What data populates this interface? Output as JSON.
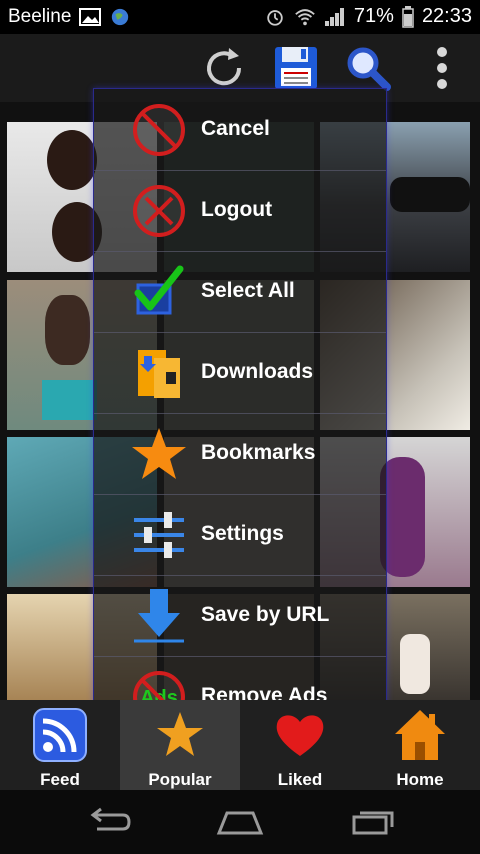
{
  "status_bar": {
    "carrier": "Beeline",
    "battery": "71%",
    "time": "22:33"
  },
  "action_bar": {
    "icons": [
      "refresh-icon",
      "save-icon",
      "search-icon",
      "overflow-icon"
    ]
  },
  "menu": {
    "items": [
      {
        "label": "Cancel",
        "icon": "cancel-icon"
      },
      {
        "label": "Logout",
        "icon": "logout-icon"
      },
      {
        "label": "Select All",
        "icon": "checkbox-icon"
      },
      {
        "label": "Downloads",
        "icon": "downloads-icon"
      },
      {
        "label": "Bookmarks",
        "icon": "star-icon"
      },
      {
        "label": "Settings",
        "icon": "sliders-icon"
      },
      {
        "label": "Save by URL",
        "icon": "download-arrow-icon"
      },
      {
        "label": "Remove Ads",
        "icon": "no-ads-icon",
        "icon_text": "Ads"
      }
    ]
  },
  "tabs": [
    {
      "label": "Feed",
      "icon": "rss-icon",
      "active": false
    },
    {
      "label": "Popular",
      "icon": "popular-icon",
      "active": true
    },
    {
      "label": "Liked",
      "icon": "heart-icon",
      "active": false
    },
    {
      "label": "Home",
      "icon": "home-icon",
      "active": false
    }
  ],
  "colors": {
    "menu_border": "#2a2a8c",
    "accent_blue": "#1e5bd8",
    "tab_active": "#3a3a3a"
  }
}
